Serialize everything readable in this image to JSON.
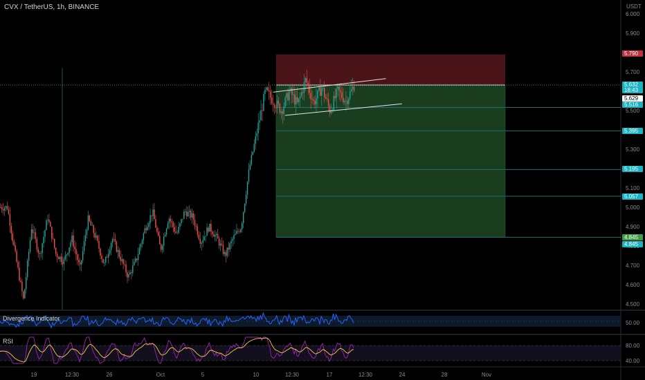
{
  "header": {
    "symbol": "CVX / TetherUS, 1h, BINANCE",
    "currency": "USDT"
  },
  "colors": {
    "background": "#000000",
    "candle_up": "#26a69a",
    "candle_down": "#ef5350",
    "stop_zone": "#4a1418",
    "target_zone": "#1a3d1f",
    "level_line": "#1f6f74",
    "tag_cyan": "#19b3c4",
    "tag_red": "#c2303c",
    "tag_green": "#3f9c45",
    "divergence_line": "#2962ff",
    "rsi_line": "#9c27b0",
    "rsi_signal": "#f5d142"
  },
  "chart_data": [
    {
      "type": "candlestick",
      "title": "CVX / TetherUS, 1h, BINANCE",
      "ylabel": "USDT",
      "ylim": [
        4.45,
        6.05
      ],
      "y_ticks": [
        "6.000",
        "5.900",
        "5.800",
        "5.700",
        "5.600",
        "5.500",
        "5.400",
        "5.300",
        "5.200",
        "5.100",
        "5.000",
        "4.900",
        "4.800",
        "4.700",
        "4.600",
        "4.500"
      ],
      "x_ticks": [
        "19",
        "12:30",
        "26",
        "Oct",
        "5",
        "10",
        "12:30",
        "17",
        "12:30",
        "24",
        "28",
        "Nov"
      ],
      "price_path": [
        [
          "Sep 18 00:00",
          5.0
        ],
        [
          "Sep 18 12:00",
          4.75
        ],
        [
          "Sep 19 00:00",
          4.52
        ],
        [
          "Sep 19 12:00",
          4.9
        ],
        [
          "Sep 20 00:00",
          4.75
        ],
        [
          "Sep 20 12:00",
          4.95
        ],
        [
          "Sep 21 00:00",
          4.76
        ],
        [
          "Sep 21 12:00",
          4.72
        ],
        [
          "Sep 22 00:00",
          4.84
        ],
        [
          "Sep 22 12:00",
          4.68
        ],
        [
          "Sep 23 00:00",
          4.94
        ],
        [
          "Sep 23 12:00",
          4.84
        ],
        [
          "Sep 24 00:00",
          4.7
        ],
        [
          "Sep 24 12:00",
          4.84
        ],
        [
          "Sep 25 00:00",
          4.74
        ],
        [
          "Sep 25 12:00",
          4.64
        ],
        [
          "Sep 26 00:00",
          4.73
        ],
        [
          "Sep 26 12:00",
          4.88
        ],
        [
          "Sep 27 00:00",
          4.98
        ],
        [
          "Sep 27 12:00",
          4.78
        ],
        [
          "Sep 28 00:00",
          4.95
        ],
        [
          "Sep 28 12:00",
          4.86
        ],
        [
          "Sep 29 00:00",
          4.98
        ],
        [
          "Sep 29 12:00",
          4.95
        ],
        [
          "Sep 30 00:00",
          4.82
        ],
        [
          "Sep 30 12:00",
          4.9
        ],
        [
          "Oct 1 00:00",
          4.82
        ],
        [
          "Oct 1 12:00",
          4.9
        ],
        [
          "Oct 2 00:00",
          4.84
        ],
        [
          "Oct 2 12:00",
          4.75
        ],
        [
          "Oct 3 00:00",
          4.84
        ],
        [
          "Oct 3 12:00",
          4.9
        ],
        [
          "Oct 4 00:00",
          5.2
        ],
        [
          "Oct 4 12:00",
          5.4
        ],
        [
          "Oct 5 00:00",
          5.6
        ],
        [
          "Oct 5 12:00",
          5.55
        ],
        [
          "Oct 6 00:00",
          5.5
        ],
        [
          "Oct 6 12:00",
          5.6
        ],
        [
          "Oct 7 00:00",
          5.53
        ],
        [
          "Oct 7 12:00",
          5.66
        ],
        [
          "Oct 8 00:00",
          5.54
        ],
        [
          "Oct 8 12:00",
          5.62
        ],
        [
          "Oct 9 00:00",
          5.5
        ],
        [
          "Oct 9 12:00",
          5.6
        ],
        [
          "Oct 10 00:00",
          5.55
        ],
        [
          "Oct 10 12:00",
          5.63
        ]
      ],
      "trade_setup": {
        "entry": 5.632,
        "stop": 5.79,
        "target": 4.845,
        "levels": [
          5.516,
          5.395,
          5.195,
          5.057
        ]
      },
      "current_price": 5.632,
      "countdown": "18:43",
      "trendlines": [
        {
          "from": [
            "Oct 5 12:00",
            5.595
          ],
          "to": [
            "Oct 12 12:00",
            5.665
          ]
        },
        {
          "from": [
            "Oct 6 06:00",
            5.475
          ],
          "to": [
            "Oct 13 12:00",
            5.535
          ]
        }
      ]
    },
    {
      "type": "line",
      "title": "Divergence Indicator",
      "y_ticks": [
        "50.00"
      ],
      "series": [
        {
          "color": "#2962ff"
        }
      ]
    },
    {
      "type": "line",
      "title": "RSI",
      "y_ticks": [
        "80.00",
        "40.00"
      ],
      "series": [
        {
          "color": "#9c27b0"
        },
        {
          "color": "#f5d142"
        }
      ]
    }
  ],
  "price_tags": [
    {
      "value": "5.790",
      "style": "red"
    },
    {
      "value": "5.632",
      "style": "cyan"
    },
    {
      "value": "18:43",
      "style": "cyan"
    },
    {
      "value": "5.629",
      "style": "white"
    },
    {
      "value": "5.516",
      "style": "cyan"
    },
    {
      "value": "5.395",
      "style": "cyan"
    },
    {
      "value": "5.195",
      "style": "cyan"
    },
    {
      "value": "5.057",
      "style": "cyan"
    },
    {
      "value": "4.845",
      "style": "green"
    },
    {
      "value": "4.845",
      "style": "cyan"
    }
  ]
}
